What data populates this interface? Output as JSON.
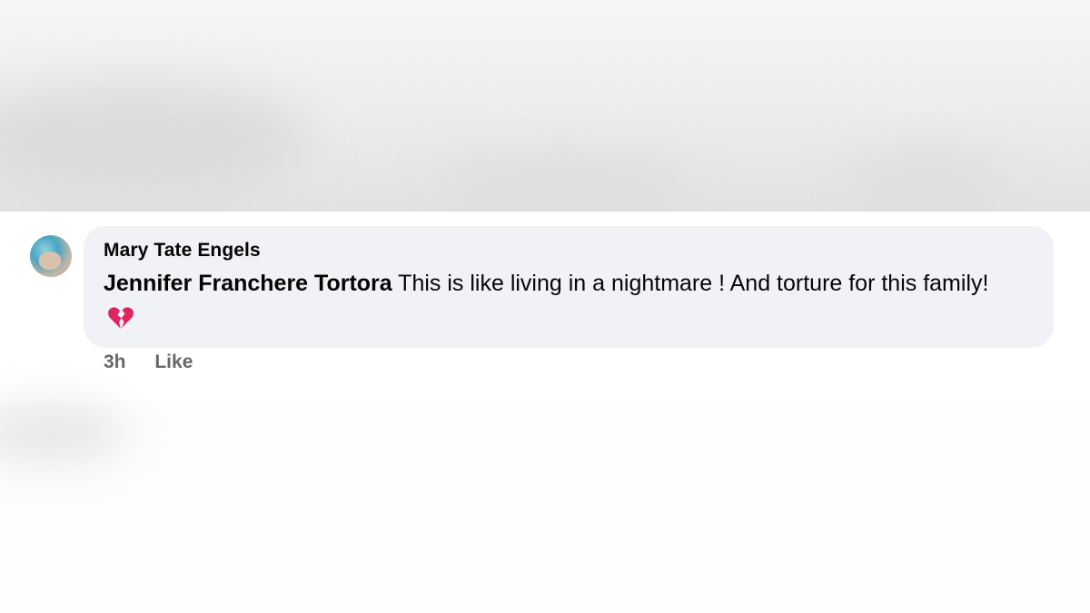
{
  "comment": {
    "author": "Mary Tate Engels",
    "mention": "Jennifer Franchere Tortora",
    "text": " This is like living in a nightmare ! And torture for this family! ",
    "emoji": "broken-heart-icon",
    "timestamp": "3h",
    "like_label": "Like"
  },
  "colors": {
    "bubble": "#f0f2f5",
    "text": "#050505",
    "meta": "#65676b",
    "heart": "#e0245e"
  }
}
